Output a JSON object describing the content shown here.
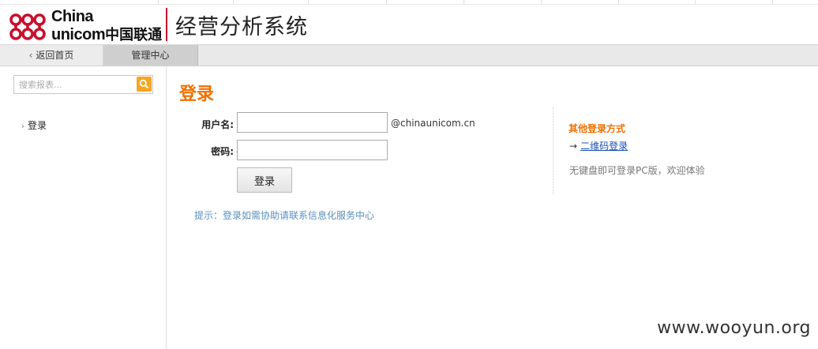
{
  "brand": {
    "logo_line1": "China",
    "logo_line2_latin": "unicom",
    "logo_line2_cn": "中国联通",
    "system_title": "经营分析系统",
    "brand_color": "#c8102e"
  },
  "nav": {
    "back_label": "返回首页",
    "admin_label": "管理中心"
  },
  "sidebar": {
    "search_placeholder": "搜索报表...",
    "items": [
      {
        "label": "登录"
      }
    ]
  },
  "login": {
    "title": "登录",
    "username_label": "用户名:",
    "username_value": "",
    "domain_suffix": "@chinaunicom.cn",
    "password_label": "密码:",
    "password_value": "",
    "submit_label": "登录",
    "hint": "提示：登录如需协助请联系信息化服务中心"
  },
  "other_login": {
    "title": "其他登录方式",
    "qr_link": "二维码登录",
    "note": "无键盘即可登录PC版，欢迎体验"
  },
  "watermark": "www.wooyun.org",
  "colors": {
    "accent_orange": "#f07000",
    "link_blue": "#1a4fb5",
    "hint_blue": "#5a8fc0",
    "search_button": "#f5a623"
  }
}
